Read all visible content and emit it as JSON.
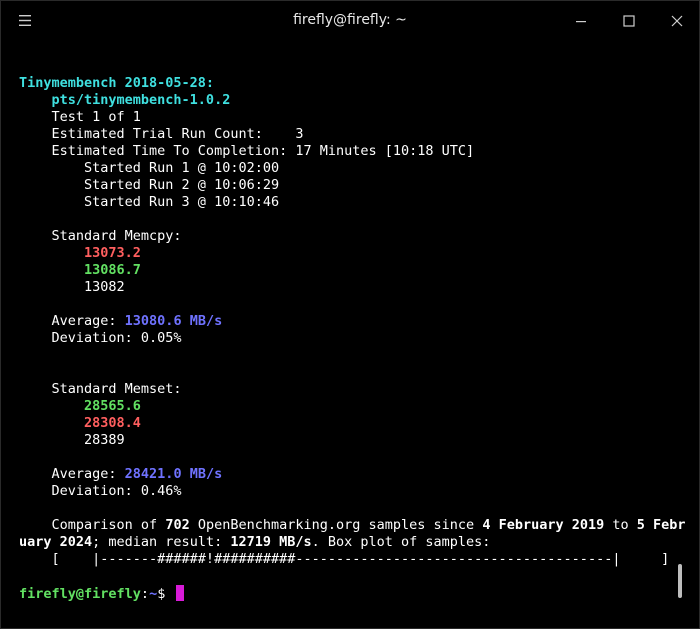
{
  "window": {
    "title": "firefly@firefly: ~"
  },
  "terminal": {
    "header": "Tinymembench 2018-05-28:",
    "profile": "    pts/tinymembench-1.0.2",
    "test": "    Test 1 of 1",
    "trial_count": "    Estimated Trial Run Count:    3",
    "time_to_completion": "    Estimated Time To Completion: 17 Minutes [10:18 UTC]",
    "runs": [
      "        Started Run 1 @ 10:02:00",
      "        Started Run 2 @ 10:06:29",
      "        Started Run 3 @ 10:10:46"
    ],
    "memcpy": {
      "title": "    Standard Memcpy:",
      "indent": "        ",
      "values": [
        "13073.2",
        "13086.7",
        "13082"
      ],
      "average_label": "    Average: ",
      "average_value": "13080.6 MB/s",
      "deviation": "    Deviation: 0.05%"
    },
    "memset": {
      "title": "    Standard Memset:",
      "indent": "        ",
      "values": [
        "28565.6",
        "28308.4",
        "28389"
      ],
      "average_label": "    Average: ",
      "average_value": "28421.0 MB/s",
      "deviation": "    Deviation: 0.46%"
    },
    "comparison": {
      "p1": "    Comparison of ",
      "count": "702",
      "p2": " OpenBenchmarking.org samples since ",
      "date_start_a": "4 February 2019",
      "p3": " to ",
      "date_end_a": "5 Febr",
      "date_end_b": "uary 2024",
      "p4": "; median result: ",
      "median": "12719 MB/s",
      "p5": ". Box plot of samples:",
      "boxplot": "    [    |-------######!##########---------------------------------------|     ]"
    },
    "prompt": {
      "user": "firefly@firefly",
      "colon": ":",
      "path": "~",
      "symbol": "$ "
    }
  },
  "colors": {
    "background": "#000000",
    "cyan": "#3fe0e0",
    "red": "#ff5f5f",
    "green": "#62e062",
    "blue": "#6f72ff",
    "cursor": "#d81bd8"
  }
}
